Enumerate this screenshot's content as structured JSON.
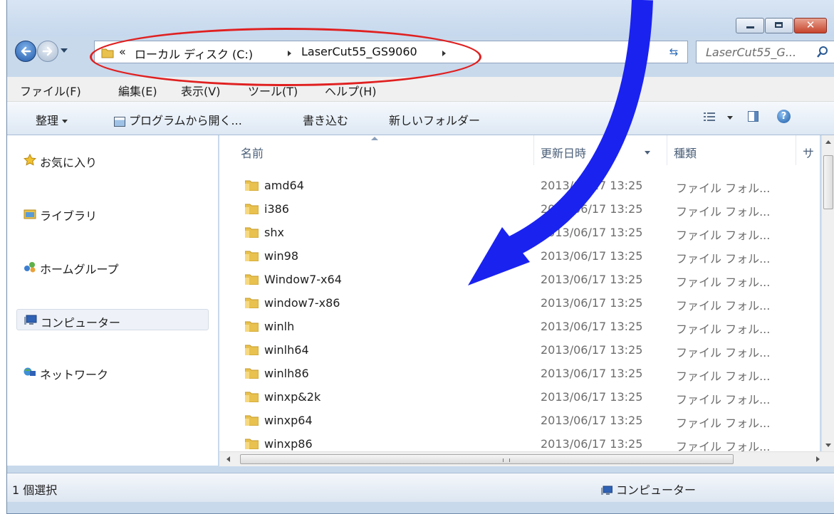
{
  "window": {
    "caption_buttons": {
      "minimize": "minimize",
      "maximize": "maximize",
      "close": "x"
    }
  },
  "address": {
    "overflow_marker": "«",
    "segments": [
      "ローカル ディスク (C:)",
      "LaserCut55_GS9060"
    ]
  },
  "search": {
    "placeholder": "LaserCut55_G..."
  },
  "menubar": {
    "items": [
      "ファイル(F)",
      "編集(E)",
      "表示(V)",
      "ツール(T)",
      "ヘルプ(H)"
    ]
  },
  "toolbar": {
    "organize": "整理",
    "open_with": "プログラムから開く...",
    "burn": "書き込む",
    "new_folder": "新しいフォルダー",
    "help": "?"
  },
  "navpane": {
    "favorites": "お気に入り",
    "libraries": "ライブラリ",
    "homegroup": "ホームグループ",
    "computer": "コンピューター",
    "network": "ネットワーク"
  },
  "columns": {
    "name": "名前",
    "date": "更新日時",
    "type": "種類",
    "size": "サ"
  },
  "files": [
    {
      "name": "amd64",
      "date": "2013/06/17 13:25",
      "type": "ファイル フォル..."
    },
    {
      "name": "i386",
      "date": "2013/06/17 13:25",
      "type": "ファイル フォル..."
    },
    {
      "name": "shx",
      "date": "2013/06/17 13:25",
      "type": "ファイル フォル..."
    },
    {
      "name": "win98",
      "date": "2013/06/17 13:25",
      "type": "ファイル フォル..."
    },
    {
      "name": "Window7-x64",
      "date": "2013/06/17 13:25",
      "type": "ファイル フォル..."
    },
    {
      "name": "window7-x86",
      "date": "2013/06/17 13:25",
      "type": "ファイル フォル..."
    },
    {
      "name": "winlh",
      "date": "2013/06/17 13:25",
      "type": "ファイル フォル..."
    },
    {
      "name": "winlh64",
      "date": "2013/06/17 13:25",
      "type": "ファイル フォル..."
    },
    {
      "name": "winlh86",
      "date": "2013/06/17 13:25",
      "type": "ファイル フォル..."
    },
    {
      "name": "winxp&2k",
      "date": "2013/06/17 13:25",
      "type": "ファイル フォル..."
    },
    {
      "name": "winxp64",
      "date": "2013/06/17 13:25",
      "type": "ファイル フォル..."
    },
    {
      "name": "winxp86",
      "date": "2013/06/17 13:25",
      "type": "ファイル フォル..."
    }
  ],
  "statusbar": {
    "selection": "1 個選択",
    "location": "コンピューター"
  },
  "colors": {
    "annotation_ellipse": "#e02020",
    "annotation_arrow": "#1a22f0",
    "folder": "#e8c14e",
    "window_frame": "#c8d9ec"
  }
}
